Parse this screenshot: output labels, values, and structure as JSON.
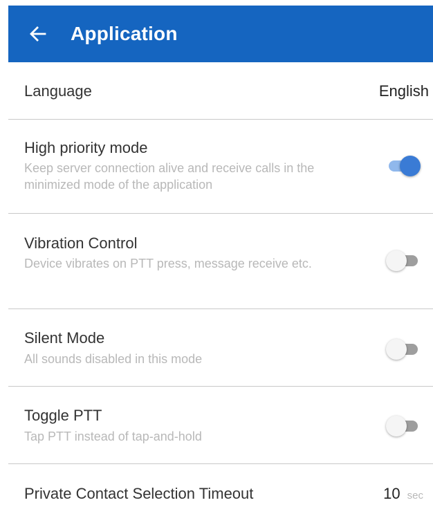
{
  "appbar": {
    "title": "Application",
    "back_icon": "arrow-left-icon",
    "color": "#1565c0"
  },
  "settings": {
    "language": {
      "label": "Language",
      "value": "English"
    },
    "high_priority": {
      "title": "High priority mode",
      "subtitle": "Keep server connection alive and receive calls in the minimized mode of the application",
      "enabled": true
    },
    "vibration": {
      "title": "Vibration Control",
      "subtitle": "Device vibrates on PTT press, message receive etc.",
      "enabled": false
    },
    "silent": {
      "title": "Silent Mode",
      "subtitle": "All sounds disabled in this mode",
      "enabled": false
    },
    "toggle_ptt": {
      "title": "Toggle PTT",
      "subtitle": "Tap PTT instead of tap-and-hold",
      "enabled": false
    },
    "private_timeout": {
      "title": "Private Contact Selection Timeout",
      "value": "10",
      "unit": "sec"
    }
  }
}
